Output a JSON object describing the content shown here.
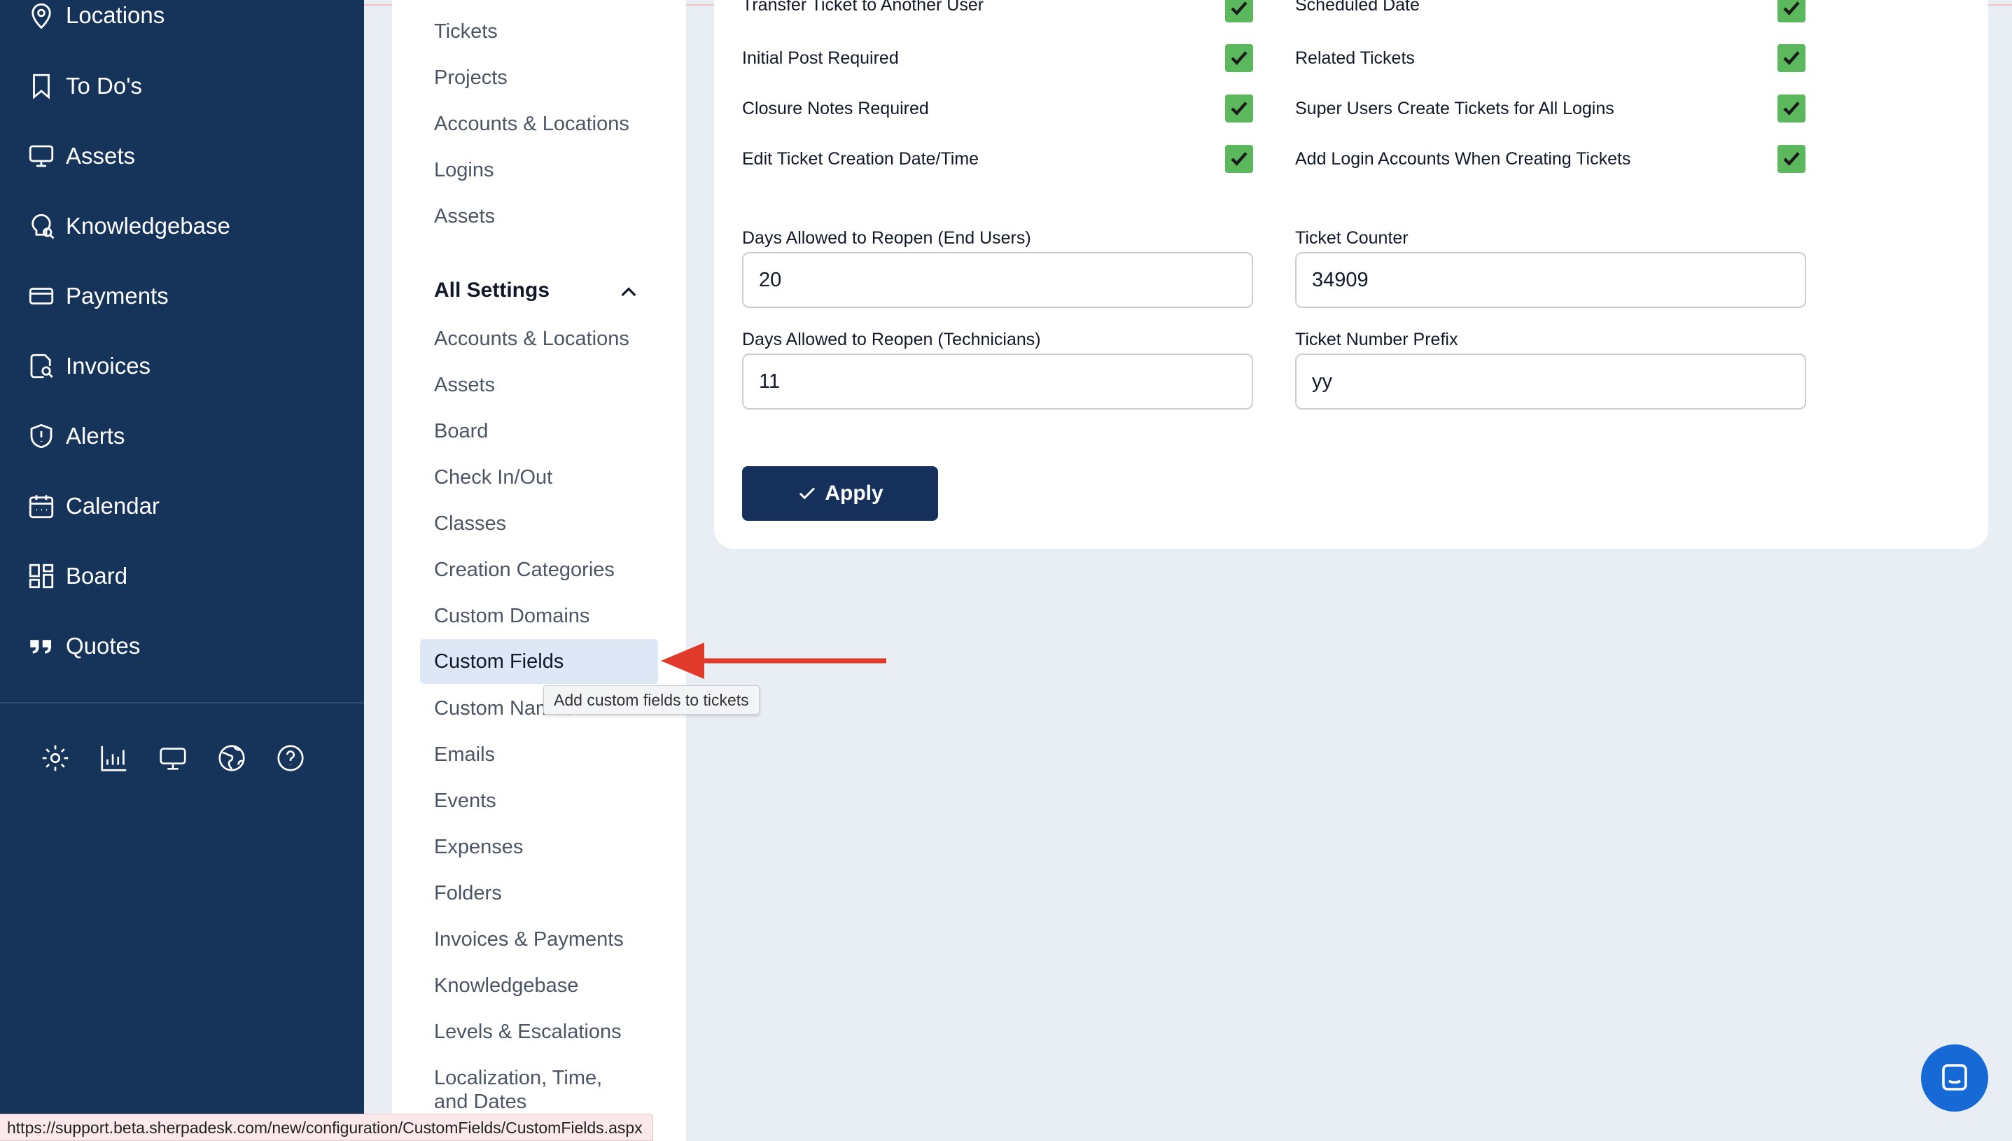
{
  "sidebar": {
    "items": [
      {
        "label": "Locations",
        "icon": "location-pin-icon"
      },
      {
        "label": "To Do's",
        "icon": "bookmark-icon"
      },
      {
        "label": "Assets",
        "icon": "monitor-icon"
      },
      {
        "label": "Knowledgebase",
        "icon": "knowledgebase-icon"
      },
      {
        "label": "Payments",
        "icon": "credit-card-icon"
      },
      {
        "label": "Invoices",
        "icon": "invoice-search-icon"
      },
      {
        "label": "Alerts",
        "icon": "shield-alert-icon"
      },
      {
        "label": "Calendar",
        "icon": "calendar-icon"
      },
      {
        "label": "Board",
        "icon": "board-icon"
      },
      {
        "label": "Quotes",
        "icon": "quote-icon"
      }
    ],
    "utility_icons": [
      "gear-icon",
      "chart-icon",
      "monitor-icon",
      "globe-icon",
      "help-icon"
    ]
  },
  "settings_nav": {
    "top_links": [
      "Tickets",
      "Projects",
      "Accounts & Locations",
      "Logins",
      "Assets"
    ],
    "all_settings_heading": "All Settings",
    "links": [
      "Accounts & Locations",
      "Assets",
      "Board",
      "Check In/Out",
      "Classes",
      "Creation Categories",
      "Custom Domains",
      "Custom Fields",
      "Custom Names",
      "Emails",
      "Events",
      "Expenses",
      "Folders",
      "Invoices & Payments",
      "Knowledgebase",
      "Levels & Escalations",
      "Localization, Time,",
      "and Dates"
    ],
    "active": "Custom Fields",
    "tooltip": "Add custom fields to tickets"
  },
  "options": {
    "left": [
      {
        "label": "Transfer Ticket to Another User",
        "checked": true
      },
      {
        "label": "Initial Post Required",
        "checked": true
      },
      {
        "label": "Closure Notes Required",
        "checked": true
      },
      {
        "label": "Edit Ticket Creation Date/Time",
        "checked": true
      }
    ],
    "right": [
      {
        "label": "Scheduled Date",
        "checked": true
      },
      {
        "label": "Related Tickets",
        "checked": true
      },
      {
        "label": "Super Users Create Tickets for All Logins",
        "checked": true
      },
      {
        "label": "Add Login Accounts When Creating Tickets",
        "checked": true
      }
    ]
  },
  "fields": {
    "reopen_end_users": {
      "label": "Days Allowed to Reopen (End Users)",
      "value": "20"
    },
    "ticket_counter": {
      "label": "Ticket Counter",
      "value": "34909"
    },
    "reopen_technicians": {
      "label": "Days Allowed to Reopen (Technicians)",
      "value": "11"
    },
    "ticket_prefix": {
      "label": "Ticket Number Prefix",
      "value": "yy"
    }
  },
  "apply_label": "Apply",
  "status_url": "https://support.beta.sherpadesk.com/new/configuration/CustomFields/CustomFields.aspx",
  "colors": {
    "sidebar_bg": "#163359",
    "accent_button": "#15305a",
    "checkbox_green": "#5cb85c",
    "annotation_arrow": "#e03a2a",
    "chat_blue": "#1769d6"
  }
}
